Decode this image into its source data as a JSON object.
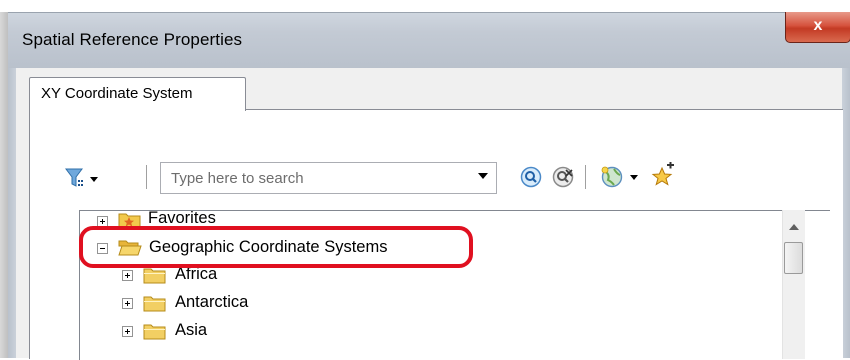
{
  "window": {
    "title": "Spatial Reference Properties",
    "close_label": "x"
  },
  "tabs": [
    {
      "label": "XY Coordinate System",
      "active": true
    }
  ],
  "toolbar": {
    "filter_icon": "filter-icon",
    "search_placeholder": "Type here to search",
    "search_value": "",
    "search_button_icon": "search-icon",
    "clear_search_icon": "clear-search-icon",
    "globe_icon": "globe-icon",
    "add_favorite_icon": "add-to-favorites-icon"
  },
  "tree": {
    "items": [
      {
        "label": "Favorites",
        "expanded": false,
        "level": 0,
        "icon": "favorites-folder-icon"
      },
      {
        "label": "Geographic Coordinate Systems",
        "expanded": true,
        "level": 0,
        "icon": "open-folder-icon",
        "highlighted": true
      },
      {
        "label": "Africa",
        "expanded": false,
        "level": 1,
        "icon": "folder-icon"
      },
      {
        "label": "Antarctica",
        "expanded": false,
        "level": 1,
        "icon": "folder-icon"
      },
      {
        "label": "Asia",
        "expanded": false,
        "level": 1,
        "icon": "folder-icon"
      }
    ]
  },
  "colors": {
    "highlight": "#e01020",
    "close_button": "#c33a24",
    "titlebar": "#c3cad4"
  }
}
